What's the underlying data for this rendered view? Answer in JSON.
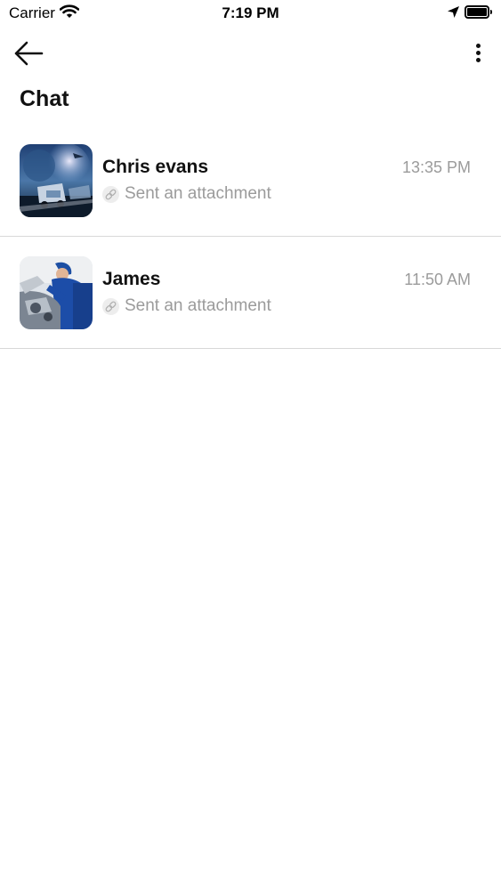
{
  "status_bar": {
    "carrier": "Carrier",
    "time": "7:19 PM"
  },
  "header": {
    "title": "Chat",
    "back_icon": "arrow-left-icon",
    "menu_icon": "more-vertical-icon"
  },
  "chats": [
    {
      "name": "Chris evans",
      "time": "13:35 PM",
      "preview": "Sent an attachment",
      "preview_icon": "link-icon"
    },
    {
      "name": "James",
      "time": "11:50 AM",
      "preview": "Sent an attachment",
      "preview_icon": "link-icon"
    }
  ],
  "colors": {
    "text_primary": "#111111",
    "text_secondary": "#9b9b9b",
    "divider": "#d8d8d8"
  }
}
